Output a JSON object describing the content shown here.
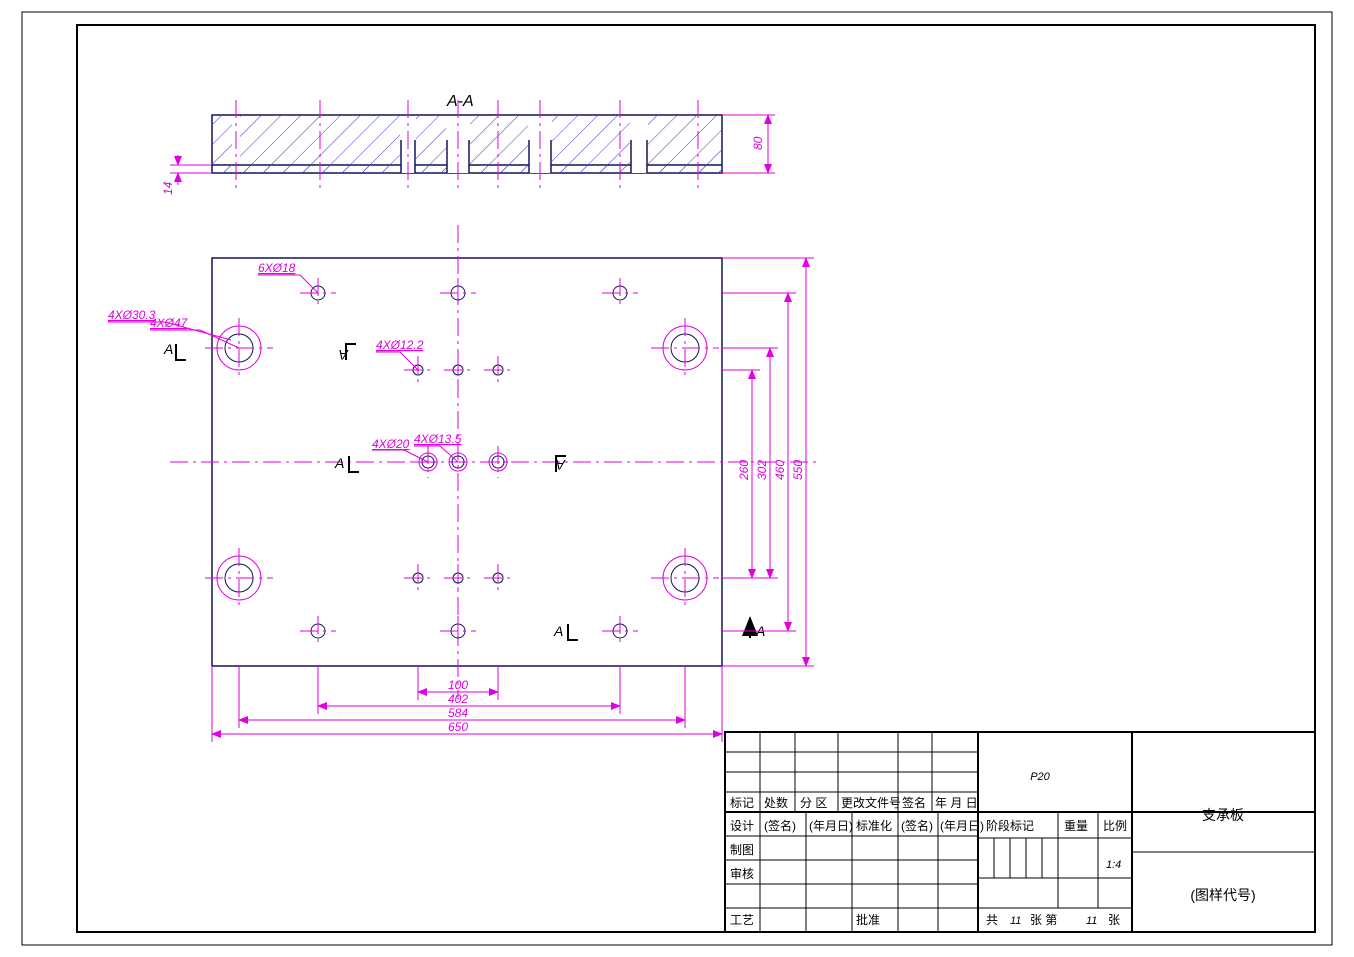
{
  "section_label": "A-A",
  "section_marks": {
    "A": "A"
  },
  "dims_section": {
    "height": "80",
    "step": "14"
  },
  "dims_plan_h": {
    "d1": "100",
    "d2": "402",
    "d3": "584",
    "d4": "650"
  },
  "dims_plan_v": {
    "d1": "260",
    "d2": "302",
    "d3": "460",
    "d4": "550"
  },
  "callouts": {
    "c1": "6XØ18",
    "c2": "4XØ30.3",
    "c3": "4XØ47",
    "c4": "4XØ12.2",
    "c5": "4XØ20",
    "c6": "4XØ13.5"
  },
  "title_block": {
    "rev_headers": [
      "标记",
      "处数",
      "分  区",
      "更改文件号",
      "签名",
      "年 月 日"
    ],
    "rows": {
      "design": "设计",
      "design_sig": "(签名)",
      "design_date": "(年月日)",
      "std": "标准化",
      "std_sig": "(签名)",
      "std_date": "(年月日)",
      "draft": "制图",
      "check": "审核",
      "proc": "工艺",
      "approve": "批准"
    },
    "stage": "阶段标记",
    "mass": "重量",
    "scale_lbl": "比例",
    "scale_val": "1:4",
    "material": "P20",
    "part_name": "支承板",
    "drawing_no": "(图样代号)",
    "sheets_prefix": "共",
    "sheets_mid": "张  第",
    "sheets_suffix": "张",
    "sheet_total": "11",
    "sheet_no": "11"
  }
}
